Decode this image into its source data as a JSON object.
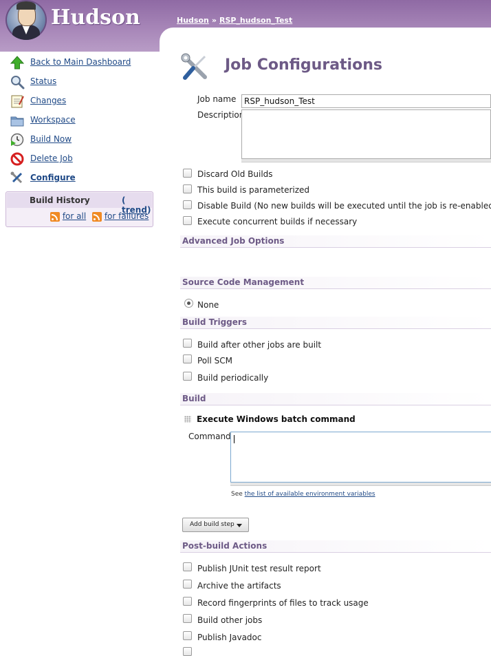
{
  "header": {
    "app_name": "Hudson",
    "breadcrumb": [
      "Hudson",
      "RSP_hudson_Test"
    ],
    "breadcrumb_separator": "»"
  },
  "sidebar": {
    "items": [
      {
        "label": "Back to Main Dashboard",
        "icon": "up-arrow-icon"
      },
      {
        "label": "Status",
        "icon": "magnifier-icon"
      },
      {
        "label": "Changes",
        "icon": "notepad-icon"
      },
      {
        "label": "Workspace",
        "icon": "folder-icon"
      },
      {
        "label": "Build Now",
        "icon": "clock-play-icon"
      },
      {
        "label": "Delete Job",
        "icon": "no-entry-icon"
      },
      {
        "label": "Configure",
        "icon": "wrench-screwdriver-icon"
      }
    ],
    "build_history": {
      "title": "Build History",
      "trend_open": "(",
      "trend_label": "trend",
      "trend_close": ")",
      "for_all": "for all",
      "for_failures": "for failures"
    }
  },
  "main": {
    "title": "Job Configurations",
    "job_name_label": "Job name",
    "job_name_value": "RSP_hudson_Test",
    "description_label": "Description",
    "description_value": "",
    "general_options": [
      {
        "label": "Discard Old Builds",
        "checked": false
      },
      {
        "label": "This build is parameterized",
        "checked": false
      },
      {
        "label": "Disable Build (No new builds will be executed until the job is re-enabled.)",
        "checked": false
      },
      {
        "label": "Execute concurrent builds if necessary",
        "checked": false
      }
    ],
    "sections": {
      "advanced": "Advanced Job Options",
      "scm": "Source Code Management",
      "triggers": "Build Triggers",
      "build": "Build",
      "post_build": "Post-build Actions"
    },
    "scm_option": {
      "label": "None",
      "selected": true
    },
    "triggers": [
      {
        "label": "Build after other jobs are built",
        "checked": false
      },
      {
        "label": "Poll SCM",
        "checked": false
      },
      {
        "label": "Build periodically",
        "checked": false
      }
    ],
    "build_step": {
      "title": "Execute Windows batch command",
      "command_label": "Command",
      "command_value": "",
      "see_text": "See",
      "see_link": "the list of available environment variables"
    },
    "add_build_step": "Add build step",
    "post_build_actions": [
      {
        "label": "Publish JUnit test result report",
        "checked": false
      },
      {
        "label": "Archive the artifacts",
        "checked": false
      },
      {
        "label": "Record fingerprints of files to track usage",
        "checked": false
      },
      {
        "label": "Build other jobs",
        "checked": false
      },
      {
        "label": "Publish Javadoc",
        "checked": false
      }
    ]
  }
}
